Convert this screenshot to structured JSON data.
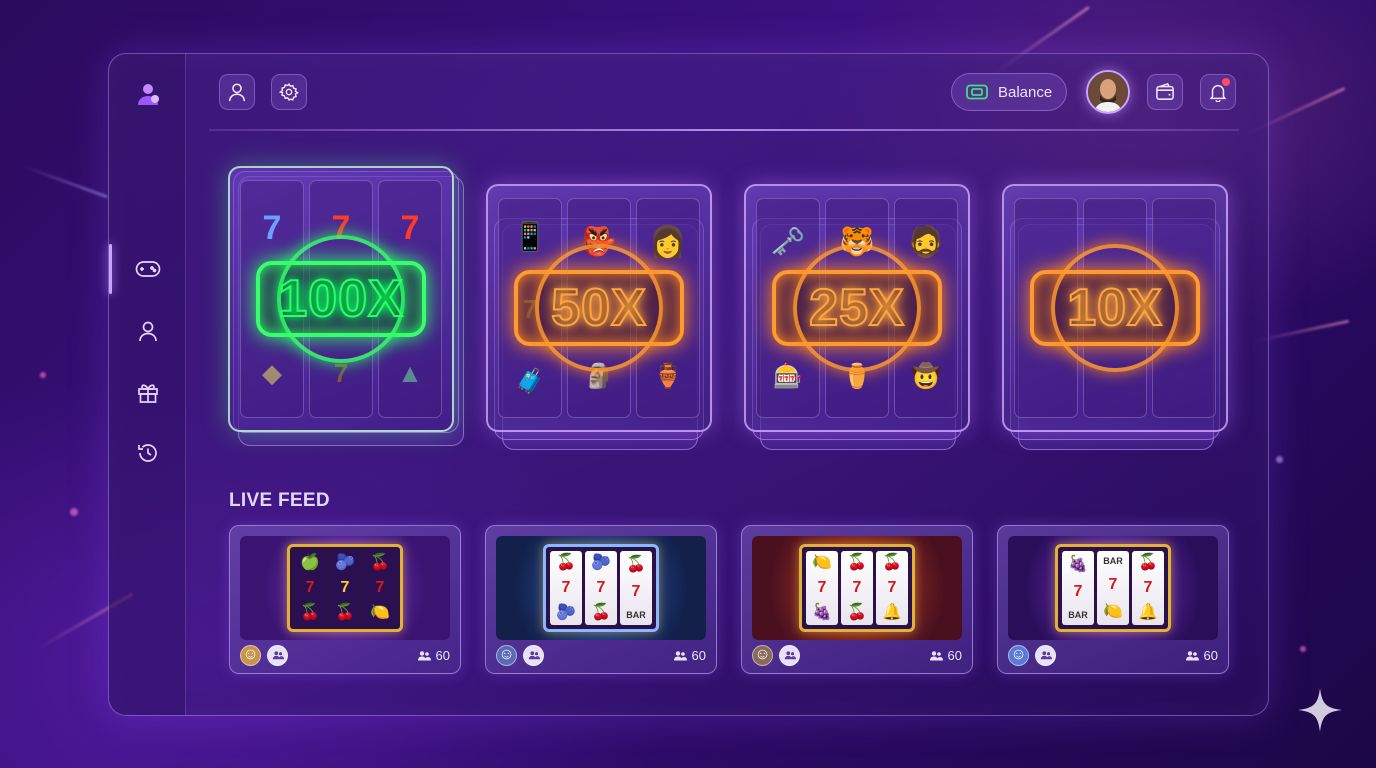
{
  "topbar": {
    "balance_label": "Balance",
    "icons": [
      "user-icon",
      "gear-icon",
      "wallet-icon",
      "bell-icon"
    ]
  },
  "sidebar": {
    "items": [
      {
        "name": "games",
        "icon": "gamepad-icon",
        "active": true
      },
      {
        "name": "profile",
        "icon": "user-icon",
        "active": false
      },
      {
        "name": "rewards",
        "icon": "gift-icon",
        "active": false
      },
      {
        "name": "history",
        "icon": "history-icon",
        "active": false
      }
    ]
  },
  "multipliers": [
    {
      "label": "100X",
      "color": "green"
    },
    {
      "label": "50X",
      "color": "orange"
    },
    {
      "label": "25X",
      "color": "orange"
    },
    {
      "label": "10X",
      "color": "orange"
    }
  ],
  "live_feed": {
    "title": "LIVE FEED",
    "cards": [
      {
        "count": "60",
        "reels": [
          [
            "🍏",
            "7",
            "🍒"
          ],
          [
            "🫐",
            "7",
            "🍒"
          ],
          [
            "🍒",
            "7",
            "🍋"
          ]
        ]
      },
      {
        "count": "60",
        "reels": [
          [
            "🍒",
            "7",
            "🫐"
          ],
          [
            "🫐",
            "7",
            "🍒"
          ],
          [
            "🍒",
            "7",
            "BAR"
          ]
        ]
      },
      {
        "count": "60",
        "reels": [
          [
            "🍋",
            "7",
            "🍇"
          ],
          [
            "🍒",
            "7",
            "🍒"
          ],
          [
            "🍒",
            "7",
            "🔔"
          ]
        ]
      },
      {
        "count": "60",
        "reels": [
          [
            "🍇",
            "7",
            "BAR"
          ],
          [
            "BAR",
            "7",
            "🍋"
          ],
          [
            "🍒",
            "7",
            "🔔"
          ]
        ]
      }
    ]
  },
  "colors": {
    "accent": "#b48cff",
    "green_glow": "#38ff6c",
    "orange_glow": "#ff9a2e",
    "notification": "#ff4a6a"
  }
}
